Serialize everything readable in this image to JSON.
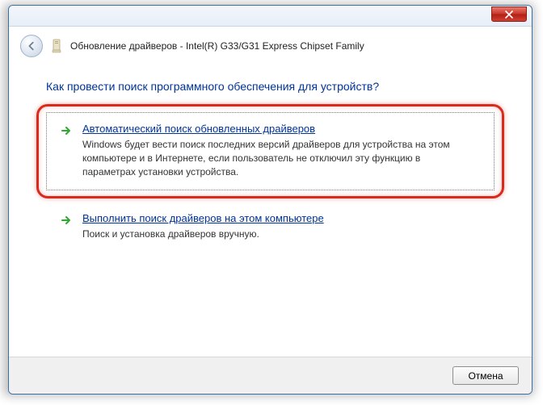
{
  "window": {
    "title": "Обновление драйверов - Intel(R) G33/G31 Express Chipset Family"
  },
  "heading": "Как провести поиск программного обеспечения для устройств?",
  "options": [
    {
      "title": "Автоматический поиск обновленных драйверов",
      "desc": "Windows будет вести поиск последних версий драйверов для устройства на этом компьютере и в Интернете, если пользователь не отключил эту функцию в параметрах установки устройства."
    },
    {
      "title": "Выполнить поиск драйверов на этом компьютере",
      "desc": "Поиск и установка драйверов вручную."
    }
  ],
  "buttons": {
    "cancel": "Отмена"
  }
}
